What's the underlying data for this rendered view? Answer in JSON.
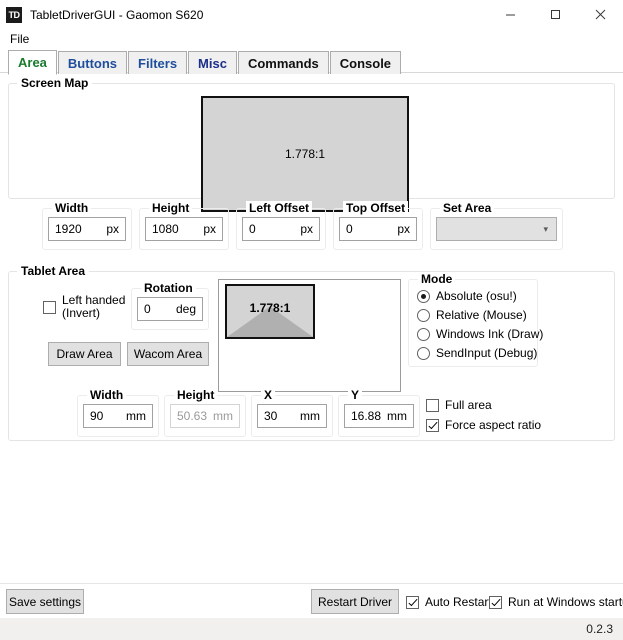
{
  "window": {
    "icon_label": "TD",
    "title": "TabletDriverGUI - Gaomon S620",
    "minimize_icon": "minimize-icon",
    "maximize_icon": "maximize-icon",
    "close_icon": "close-icon"
  },
  "menubar": {
    "items": [
      {
        "label": "File"
      }
    ]
  },
  "tabs": [
    {
      "label": "Area",
      "active": true,
      "color": "#1a7a2e"
    },
    {
      "label": "Buttons",
      "active": false,
      "color": "#1f4e9c"
    },
    {
      "label": "Filters",
      "active": false,
      "color": "#1f4e9c"
    },
    {
      "label": "Misc",
      "active": false,
      "color": "#1b2f8a"
    },
    {
      "label": "Commands",
      "active": false,
      "color": "#101010"
    },
    {
      "label": "Console",
      "active": false,
      "color": "#101010"
    }
  ],
  "screen_map": {
    "title": "Screen Map",
    "preview_ratio": "1.778:1",
    "fields": [
      {
        "title": "Width",
        "value": "1920",
        "unit": "px",
        "disabled": false
      },
      {
        "title": "Height",
        "value": "1080",
        "unit": "px",
        "disabled": false
      },
      {
        "title": "Left Offset",
        "value": "0",
        "unit": "px",
        "disabled": false
      },
      {
        "title": "Top Offset",
        "value": "0",
        "unit": "px",
        "disabled": false
      }
    ],
    "set_area": {
      "title": "Set Area",
      "value": "",
      "chevron": "chevron-down-icon"
    }
  },
  "tablet_area": {
    "title": "Tablet Area",
    "left_handed": {
      "label": "Left handed (Invert)",
      "checked": false
    },
    "rotation": {
      "title": "Rotation",
      "value": "0",
      "unit": "deg"
    },
    "buttons": [
      {
        "label": "Draw Area"
      },
      {
        "label": "Wacom Area"
      }
    ],
    "preview_ratio": "1.778:1",
    "mode": {
      "title": "Mode",
      "options": [
        {
          "label": "Absolute (osu!)",
          "selected": true
        },
        {
          "label": "Relative (Mouse)",
          "selected": false
        },
        {
          "label": "Windows Ink (Draw)",
          "selected": false
        },
        {
          "label": "SendInput (Debug)",
          "selected": false
        }
      ]
    },
    "fields": [
      {
        "title": "Width",
        "value": "90",
        "unit": "mm",
        "disabled": false
      },
      {
        "title": "Height",
        "value": "50.63",
        "unit": "mm",
        "disabled": true
      },
      {
        "title": "X",
        "value": "30",
        "unit": "mm",
        "disabled": false
      },
      {
        "title": "Y",
        "value": "16.88",
        "unit": "mm",
        "disabled": false
      }
    ],
    "checkboxes": [
      {
        "label": "Full area",
        "checked": false
      },
      {
        "label": "Force aspect ratio",
        "checked": true
      }
    ]
  },
  "bottom": {
    "save_settings_label": "Save settings",
    "restart_driver_label": "Restart Driver",
    "auto_restart": {
      "label": "Auto Restart",
      "checked": true
    },
    "run_at_startup": {
      "label": "Run at Windows startup",
      "checked": true
    }
  },
  "status": {
    "version": "0.2.3"
  }
}
